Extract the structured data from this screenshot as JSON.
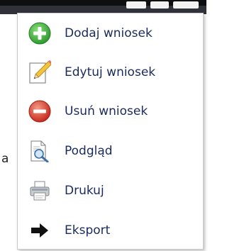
{
  "menu": {
    "items": [
      {
        "label": "Dodaj wniosek",
        "icon": "add-icon"
      },
      {
        "label": "Edytuj wniosek",
        "icon": "pencil-icon"
      },
      {
        "label": "Usuń wniosek",
        "icon": "remove-icon"
      },
      {
        "label": "Podgląd",
        "icon": "preview-icon"
      },
      {
        "label": "Drukuj",
        "icon": "printer-icon"
      },
      {
        "label": "Eksport",
        "icon": "arrow-right-icon"
      }
    ]
  },
  "background": {
    "partial_text": "a"
  },
  "colors": {
    "label": "#1a2a5c",
    "add_green": "#3fae3f",
    "remove_red": "#d83a2a",
    "pencil_yellow": "#f3c33a"
  }
}
